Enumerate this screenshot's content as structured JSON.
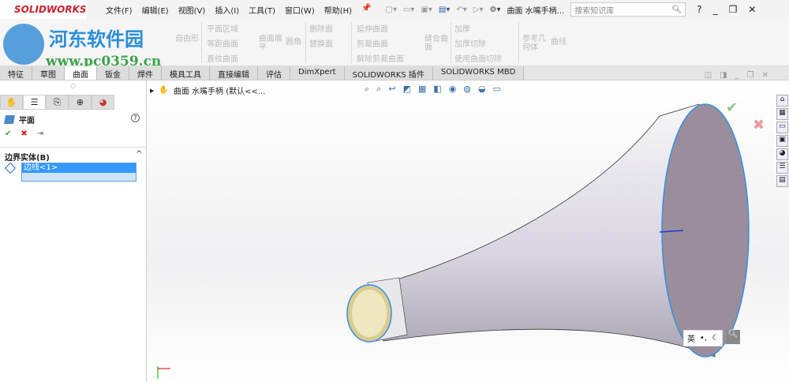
{
  "app": {
    "logo": "SOLIDWORKS",
    "menu": [
      "文件(F)",
      "编辑(E)",
      "视图(V)",
      "插入(I)",
      "工具(T)",
      "窗口(W)",
      "帮助(H)"
    ],
    "doc_title": "曲面 水嘴手柄...",
    "search_placeholder": "搜索知识库"
  },
  "watermark": {
    "name": "河东软件园",
    "url": "www.pc0359.cn"
  },
  "ribbon": {
    "free_form": "自由形",
    "col1": [
      "平面区域",
      "等距曲面",
      "直纹曲面"
    ],
    "flatten": "曲面展平",
    "fillet": "圆角",
    "col2": [
      "删除面",
      "替换面"
    ],
    "col3": [
      "延伸曲面",
      "剪裁曲面",
      "解除剪裁曲面"
    ],
    "knit": "缝合曲面",
    "col4": [
      "加厚",
      "加厚切除",
      "使用曲面切除"
    ],
    "ref_geom": "参考几何体",
    "curves": "曲线"
  },
  "tabs": [
    "特征",
    "草图",
    "曲面",
    "钣金",
    "焊件",
    "模具工具",
    "直接编辑",
    "评估",
    "DimXpert",
    "SOLIDWORKS 插件",
    "SOLIDWORKS MBD"
  ],
  "panel": {
    "title": "平面",
    "section": "边界实体(B)",
    "selection": "边线<1>"
  },
  "tree": {
    "root": "曲面 水嘴手柄 (默认<<..."
  },
  "ime": "英"
}
